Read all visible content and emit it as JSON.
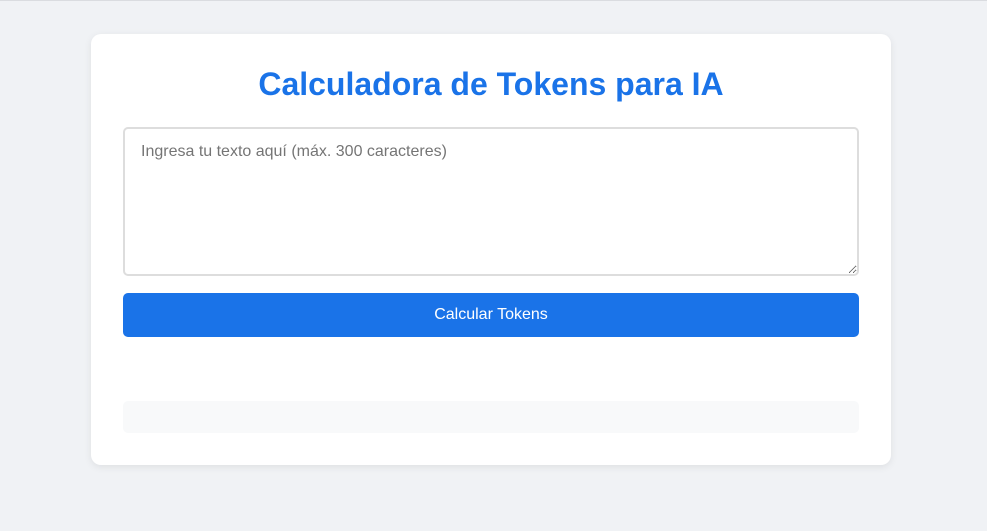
{
  "calculator": {
    "title": "Calculadora de Tokens para IA",
    "input": {
      "placeholder": "Ingresa tu texto aquí (máx. 300 caracteres)",
      "value": ""
    },
    "button_label": "Calcular Tokens",
    "result_text": ""
  },
  "colors": {
    "accent": "#1a73e8",
    "page_background": "#f0f2f5",
    "card_background": "#ffffff",
    "result_background": "#f8f9fa"
  }
}
